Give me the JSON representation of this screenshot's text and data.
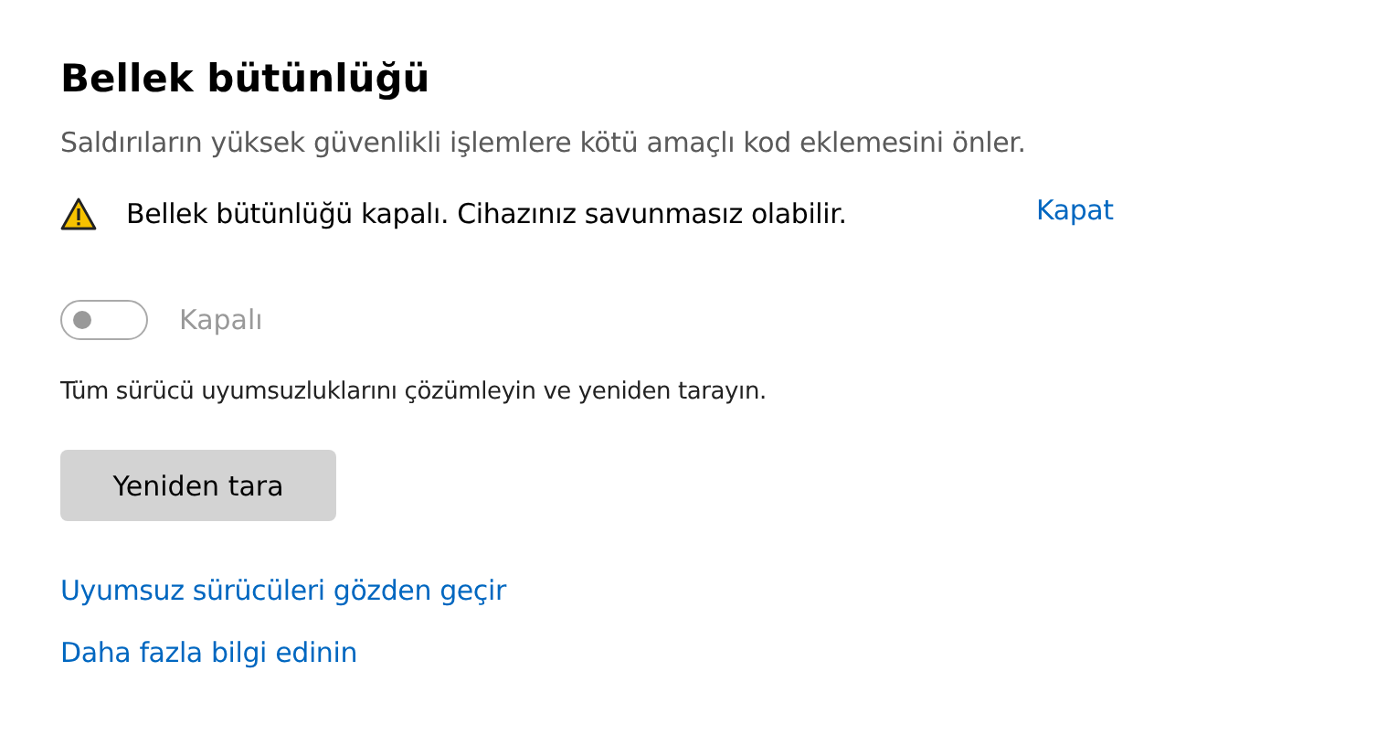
{
  "title": "Bellek bütünlüğü",
  "description": "Saldırıların yüksek güvenlikli işlemlere kötü amaçlı kod eklemesini önler.",
  "warning": {
    "text": "Bellek bütünlüğü kapalı. Cihazınız savunmasız olabilir.",
    "action": "Kapat"
  },
  "toggle": {
    "on": false,
    "disabled": true,
    "label": "Kapalı"
  },
  "note": "Tüm sürücü uyumsuzluklarını çözümleyin ve yeniden tarayın.",
  "button": "Yeniden tara",
  "links": [
    "Uyumsuz sürücüleri gözden geçir",
    "Daha fazla bilgi edinin"
  ]
}
